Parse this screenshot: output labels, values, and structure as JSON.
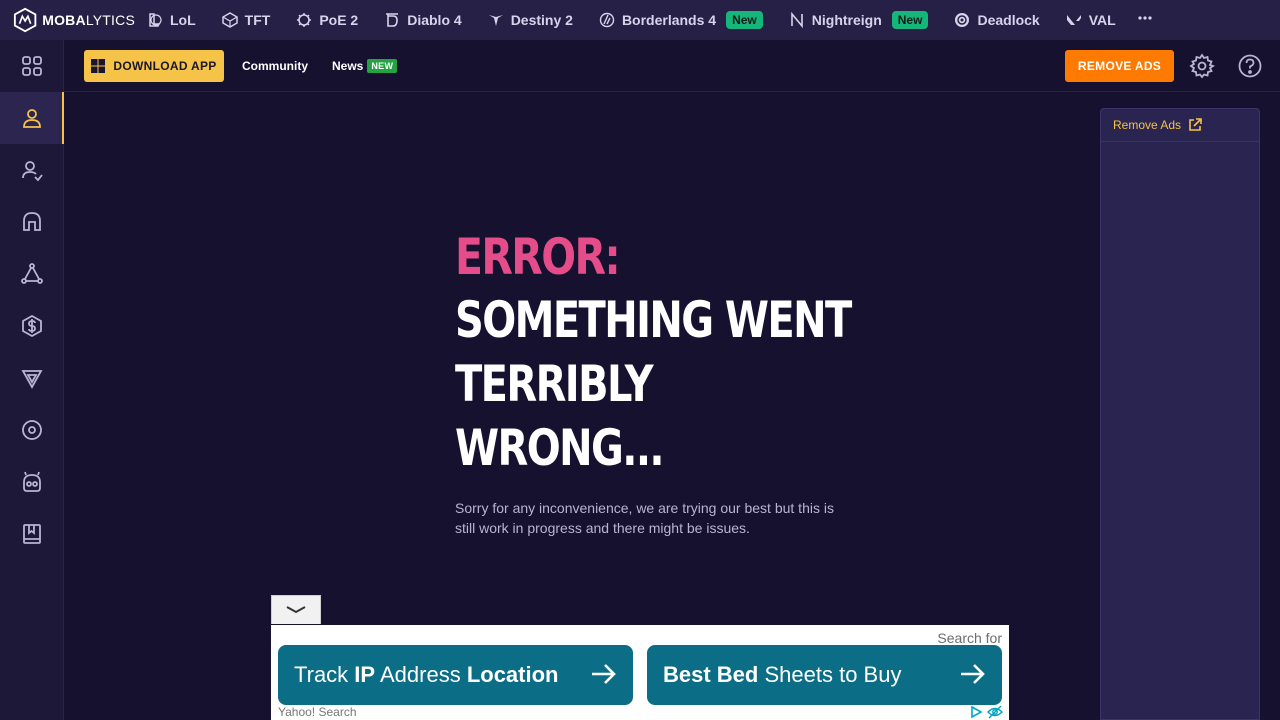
{
  "topbar": {
    "logo_bold": "MOBA",
    "logo_light": "LYTICS",
    "games": [
      {
        "label": "LoL",
        "badge": ""
      },
      {
        "label": "TFT",
        "badge": ""
      },
      {
        "label": "PoE 2",
        "badge": ""
      },
      {
        "label": "Diablo 4",
        "badge": ""
      },
      {
        "label": "Destiny 2",
        "badge": ""
      },
      {
        "label": "Borderlands 4",
        "badge": "New"
      },
      {
        "label": "Nightreign",
        "badge": "New"
      },
      {
        "label": "Deadlock",
        "badge": ""
      },
      {
        "label": "VAL",
        "badge": ""
      }
    ],
    "more_icon": "more-dots-icon"
  },
  "sidebar": {
    "items": [
      {
        "icon": "grid-icon"
      },
      {
        "icon": "user-icon",
        "active": true
      },
      {
        "icon": "users-icon"
      },
      {
        "icon": "helmet-icon"
      },
      {
        "icon": "nodes-icon"
      },
      {
        "icon": "currency-shield-icon"
      },
      {
        "icon": "triangle-badge-icon"
      },
      {
        "icon": "target-icon"
      },
      {
        "icon": "robot-icon"
      },
      {
        "icon": "book-icon"
      }
    ]
  },
  "subbar": {
    "download_label": "DOWNLOAD APP",
    "community_label": "Community",
    "news_label": "News",
    "news_badge": "NEW",
    "remove_ads_label": "REMOVE ADS"
  },
  "error": {
    "label": "ERROR:",
    "title_line1": "SOMETHING WENT",
    "title_line2": "TERRIBLY WRONG...",
    "description": "Sorry for any inconvenience, we are trying our best but this is still work in progress and there might be issues."
  },
  "ad_panel": {
    "title": "Remove Ads"
  },
  "bottom_ad": {
    "search_for": "Search for",
    "card1_parts": [
      "Track ",
      "IP",
      " Address ",
      "Location"
    ],
    "card2_parts": [
      "Best Bed",
      " Sheets to Buy"
    ],
    "provider": "Yahoo! Search"
  },
  "colors": {
    "accent": "#f5c347",
    "error": "#e44d8a",
    "remove_ads": "#ff7a00",
    "badge_new": "#15b57b",
    "ad_card": "#0b6e86"
  }
}
